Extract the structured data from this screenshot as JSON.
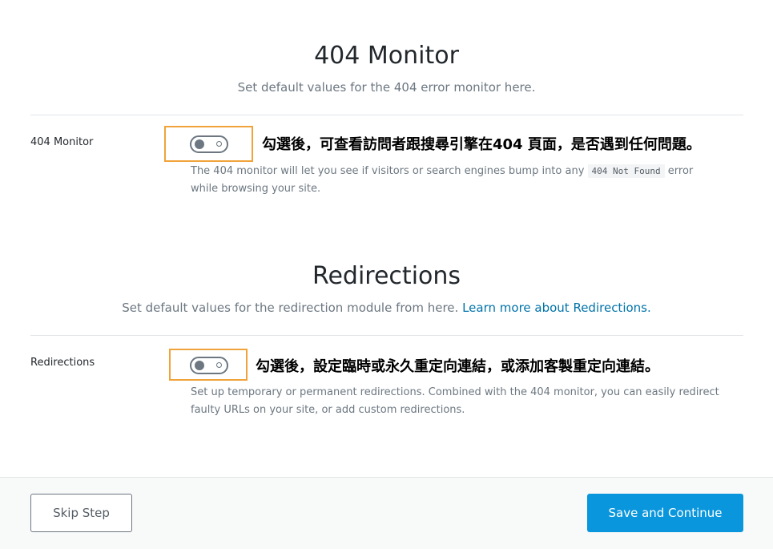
{
  "monitor_section": {
    "title": "404 Monitor",
    "subtitle": "Set default values for the 404 error monitor here.",
    "row_label": "404 Monitor",
    "annotation": "勾選後，可查看訪問者跟搜尋引擎在404 頁面，是否遇到任何問題。",
    "help_before": "The 404 monitor will let you see if visitors or search engines bump into any",
    "help_code": "404 Not Found",
    "help_after": "error while browsing your site.",
    "toggle_on": false
  },
  "redirections_section": {
    "title": "Redirections",
    "subtitle": "Set default values for the redirection module from here.",
    "learn_more_link": "Learn more about Redirections.",
    "row_label": "Redirections",
    "annotation": "勾選後，設定臨時或永久重定向連結，或添加客製重定向連結。",
    "help": "Set up temporary or permanent redirections. Combined with the 404 monitor, you can easily redirect faulty URLs on your site, or add custom redirections.",
    "toggle_on": false
  },
  "footer": {
    "skip_label": "Skip Step",
    "save_label": "Save and Continue"
  },
  "colors": {
    "accent": "#0a96dc",
    "link": "#0073aa",
    "highlight": "#f0a33a"
  }
}
